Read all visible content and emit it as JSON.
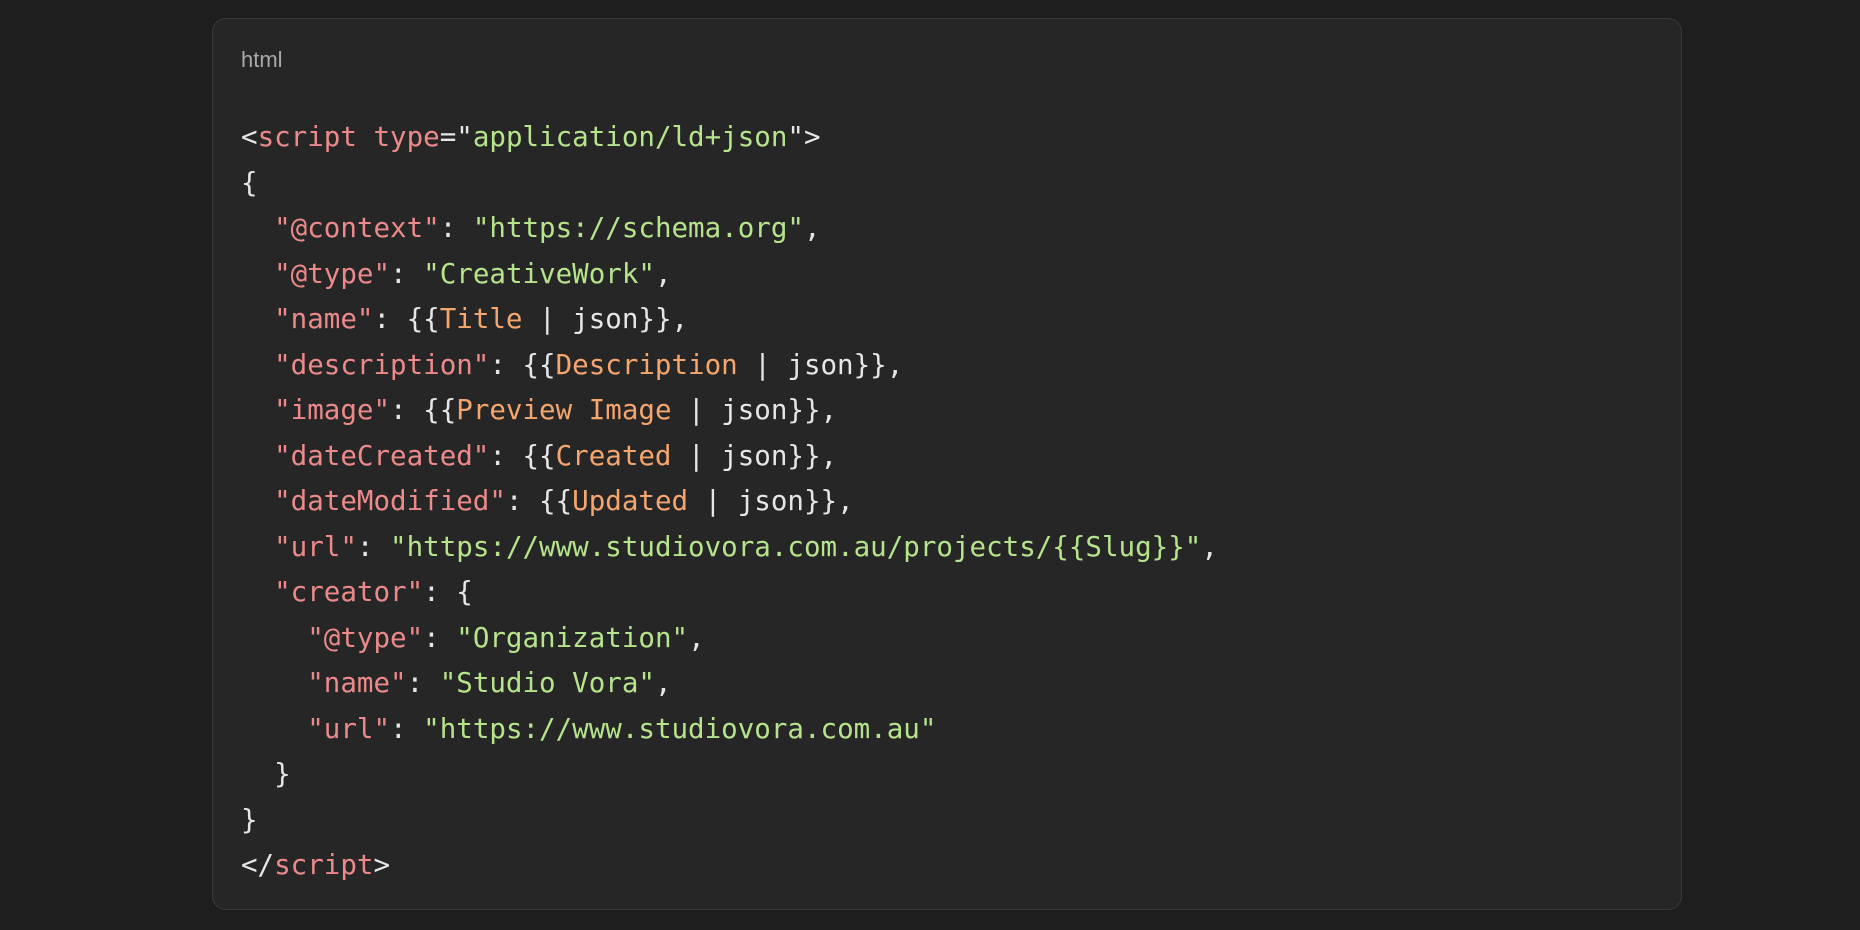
{
  "code_block": {
    "language_label": "html",
    "colors": {
      "background": "#262626",
      "page_background": "#1e1e1e",
      "punctuation": "#e6e6e6",
      "tag_and_key": "#ec8a8a",
      "string": "#b5e48c",
      "template_variable": "#f5a66f"
    },
    "lines": [
      [
        {
          "t": "punct",
          "v": "<"
        },
        {
          "t": "tag",
          "v": "script"
        },
        {
          "t": "punct",
          "v": " "
        },
        {
          "t": "attr",
          "v": "type"
        },
        {
          "t": "punct",
          "v": "=\""
        },
        {
          "t": "str",
          "v": "application/ld+json"
        },
        {
          "t": "punct",
          "v": "\">"
        }
      ],
      [
        {
          "t": "punct",
          "v": "{"
        }
      ],
      [
        {
          "t": "punct",
          "v": "  "
        },
        {
          "t": "key",
          "v": "\"@context\""
        },
        {
          "t": "punct",
          "v": ": "
        },
        {
          "t": "str",
          "v": "\"https://schema.org\""
        },
        {
          "t": "punct",
          "v": ","
        }
      ],
      [
        {
          "t": "punct",
          "v": "  "
        },
        {
          "t": "key",
          "v": "\"@type\""
        },
        {
          "t": "punct",
          "v": ": "
        },
        {
          "t": "str",
          "v": "\"CreativeWork\""
        },
        {
          "t": "punct",
          "v": ","
        }
      ],
      [
        {
          "t": "punct",
          "v": "  "
        },
        {
          "t": "key",
          "v": "\"name\""
        },
        {
          "t": "punct",
          "v": ": {{"
        },
        {
          "t": "var",
          "v": "Title"
        },
        {
          "t": "plain",
          "v": " | json"
        },
        {
          "t": "punct",
          "v": "}},"
        }
      ],
      [
        {
          "t": "punct",
          "v": "  "
        },
        {
          "t": "key",
          "v": "\"description\""
        },
        {
          "t": "punct",
          "v": ": {{"
        },
        {
          "t": "var",
          "v": "Description"
        },
        {
          "t": "plain",
          "v": " | json"
        },
        {
          "t": "punct",
          "v": "}},"
        }
      ],
      [
        {
          "t": "punct",
          "v": "  "
        },
        {
          "t": "key",
          "v": "\"image\""
        },
        {
          "t": "punct",
          "v": ": {{"
        },
        {
          "t": "var",
          "v": "Preview Image"
        },
        {
          "t": "plain",
          "v": " | json"
        },
        {
          "t": "punct",
          "v": "}},"
        }
      ],
      [
        {
          "t": "punct",
          "v": "  "
        },
        {
          "t": "key",
          "v": "\"dateCreated\""
        },
        {
          "t": "punct",
          "v": ": {{"
        },
        {
          "t": "var",
          "v": "Created"
        },
        {
          "t": "plain",
          "v": " | json"
        },
        {
          "t": "punct",
          "v": "}},"
        }
      ],
      [
        {
          "t": "punct",
          "v": "  "
        },
        {
          "t": "key",
          "v": "\"dateModified\""
        },
        {
          "t": "punct",
          "v": ": {{"
        },
        {
          "t": "var",
          "v": "Updated"
        },
        {
          "t": "plain",
          "v": " | json"
        },
        {
          "t": "punct",
          "v": "}},"
        }
      ],
      [
        {
          "t": "punct",
          "v": "  "
        },
        {
          "t": "key",
          "v": "\"url\""
        },
        {
          "t": "punct",
          "v": ": "
        },
        {
          "t": "str",
          "v": "\"https://www.studiovora.com.au/projects/{{Slug}}\""
        },
        {
          "t": "punct",
          "v": ","
        }
      ],
      [
        {
          "t": "punct",
          "v": "  "
        },
        {
          "t": "key",
          "v": "\"creator\""
        },
        {
          "t": "punct",
          "v": ": {"
        }
      ],
      [
        {
          "t": "punct",
          "v": "    "
        },
        {
          "t": "key",
          "v": "\"@type\""
        },
        {
          "t": "punct",
          "v": ": "
        },
        {
          "t": "str",
          "v": "\"Organization\""
        },
        {
          "t": "punct",
          "v": ","
        }
      ],
      [
        {
          "t": "punct",
          "v": "    "
        },
        {
          "t": "key",
          "v": "\"name\""
        },
        {
          "t": "punct",
          "v": ": "
        },
        {
          "t": "str",
          "v": "\"Studio Vora\""
        },
        {
          "t": "punct",
          "v": ","
        }
      ],
      [
        {
          "t": "punct",
          "v": "    "
        },
        {
          "t": "key",
          "v": "\"url\""
        },
        {
          "t": "punct",
          "v": ": "
        },
        {
          "t": "str",
          "v": "\"https://www.studiovora.com.au\""
        }
      ],
      [
        {
          "t": "punct",
          "v": "  }"
        }
      ],
      [
        {
          "t": "punct",
          "v": "}"
        }
      ],
      [
        {
          "t": "punct",
          "v": "</"
        },
        {
          "t": "tag",
          "v": "script"
        },
        {
          "t": "punct",
          "v": ">"
        }
      ]
    ]
  }
}
